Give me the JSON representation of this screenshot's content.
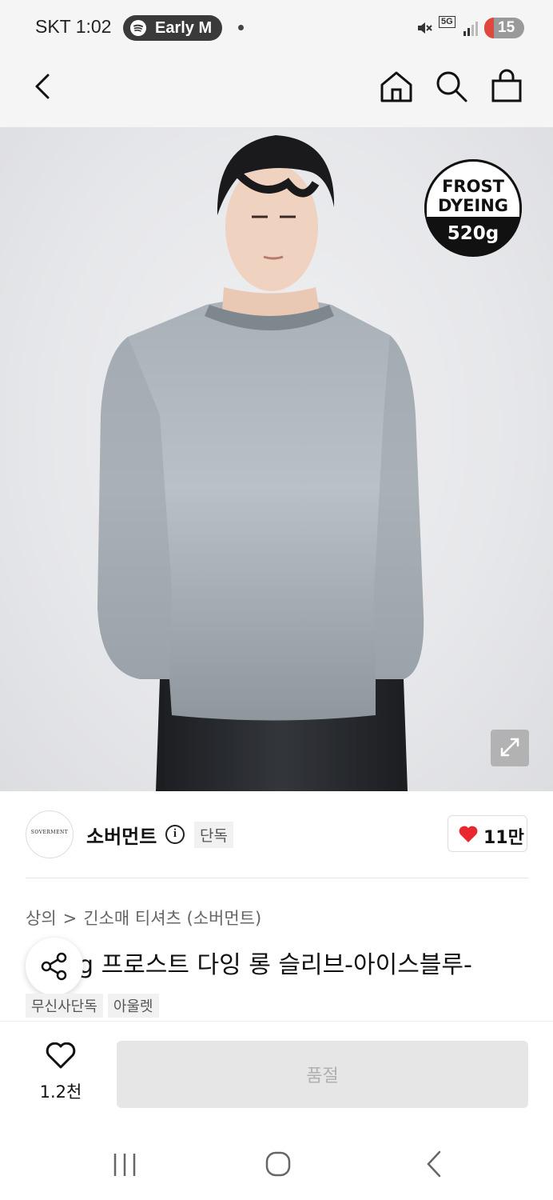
{
  "status_bar": {
    "carrier_time": "SKT 1:02",
    "media_pill": "Early M",
    "network": "5G",
    "battery": "15"
  },
  "icons": {
    "back": "back-arrow-icon",
    "home": "home-icon",
    "search": "search-icon",
    "cart": "shopping-bag-icon",
    "expand": "expand-icon",
    "info": "info-icon",
    "heart": "heart-icon",
    "share": "share-icon"
  },
  "hero": {
    "badge_line1": "FROST",
    "badge_line2": "DYEING",
    "badge_line3": "520g"
  },
  "brand": {
    "logo_text": "SOVERMENT",
    "name": "소버먼트",
    "info_glyph": "i",
    "exclusive_tag": "단독",
    "likes": "11만",
    "heart_color": "#e8282e"
  },
  "product": {
    "breadcrumb": [
      "상의",
      "긴소매 티셔츠 (소버먼트)"
    ],
    "breadcrumb_sep": ">",
    "title": "g 프로스트 다잉 롱 슬리브-아이스블루-",
    "tags": [
      "무신사단독",
      "아울렛"
    ]
  },
  "bottom_bar": {
    "wish_count": "1.2천",
    "buy_button": "품절"
  }
}
